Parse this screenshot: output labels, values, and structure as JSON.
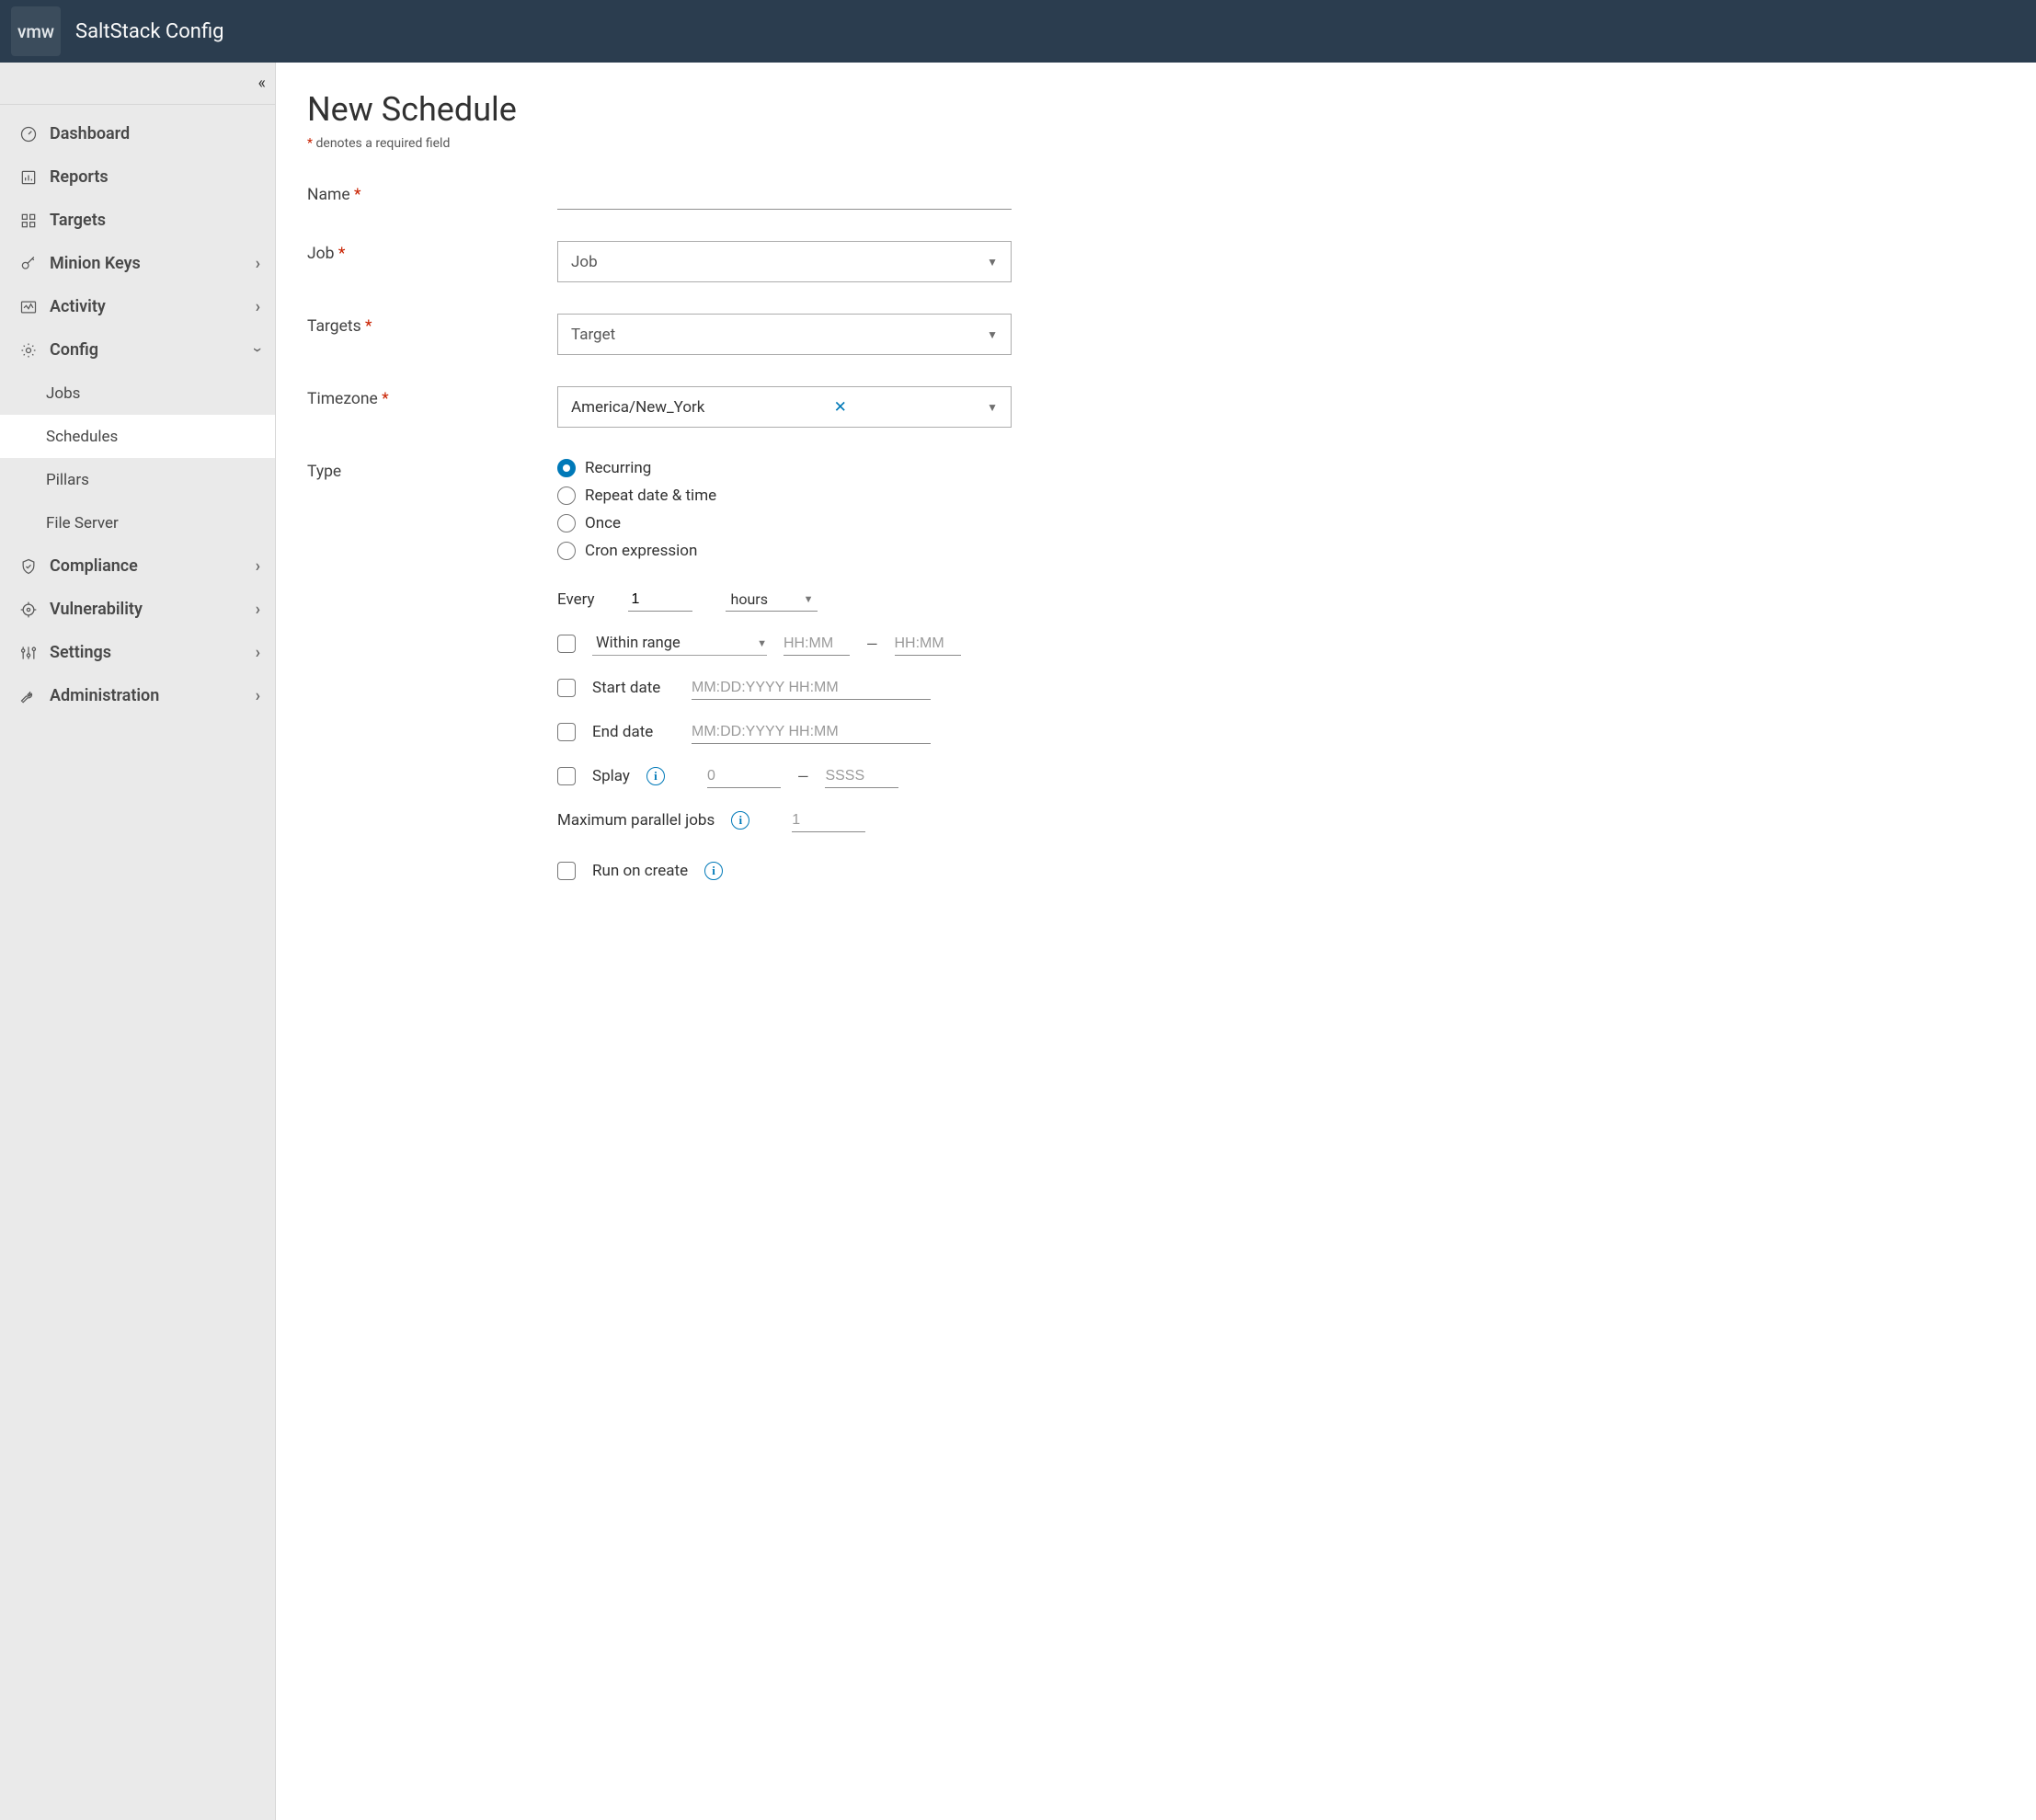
{
  "header": {
    "logo_text": "vmw",
    "app_title": "SaltStack Config"
  },
  "sidebar": {
    "items": [
      {
        "label": "Dashboard",
        "icon": "gauge-icon",
        "expandable": false
      },
      {
        "label": "Reports",
        "icon": "chart-icon",
        "expandable": false
      },
      {
        "label": "Targets",
        "icon": "grid-icon",
        "expandable": false
      },
      {
        "label": "Minion Keys",
        "icon": "key-icon",
        "expandable": true
      },
      {
        "label": "Activity",
        "icon": "activity-icon",
        "expandable": true
      },
      {
        "label": "Config",
        "icon": "gear-icon",
        "expandable": true,
        "expanded": true,
        "children": [
          {
            "label": "Jobs"
          },
          {
            "label": "Schedules",
            "active": true
          },
          {
            "label": "Pillars"
          },
          {
            "label": "File Server"
          }
        ]
      },
      {
        "label": "Compliance",
        "icon": "shield-icon",
        "expandable": true
      },
      {
        "label": "Vulnerability",
        "icon": "crosshair-icon",
        "expandable": true
      },
      {
        "label": "Settings",
        "icon": "sliders-icon",
        "expandable": true
      },
      {
        "label": "Administration",
        "icon": "wrench-icon",
        "expandable": true
      }
    ]
  },
  "page": {
    "title": "New Schedule",
    "required_note_prefix": "*",
    "required_note": " denotes a required field"
  },
  "form": {
    "labels": {
      "name": "Name",
      "job": "Job",
      "targets": "Targets",
      "timezone": "Timezone",
      "type": "Type"
    },
    "name_value": "",
    "job_placeholder": "Job",
    "targets_placeholder": "Target",
    "timezone_value": "America/New_York",
    "type_options": [
      {
        "label": "Recurring",
        "selected": true
      },
      {
        "label": "Repeat date & time",
        "selected": false
      },
      {
        "label": "Once",
        "selected": false
      },
      {
        "label": "Cron expression",
        "selected": false
      }
    ],
    "recurring": {
      "every_label": "Every",
      "every_value": "1",
      "every_unit": "hours",
      "within_range_label": "Within range",
      "hhmm_placeholder": "HH:MM",
      "range_dash": "—",
      "start_date_label": "Start date",
      "end_date_label": "End date",
      "datetime_placeholder": "MM:DD:YYYY HH:MM",
      "splay_label": "Splay",
      "splay_min_placeholder": "0",
      "splay_max_placeholder": "SSSS",
      "max_parallel_label": "Maximum parallel jobs",
      "max_parallel_value": "1",
      "run_on_create_label": "Run on create"
    }
  }
}
